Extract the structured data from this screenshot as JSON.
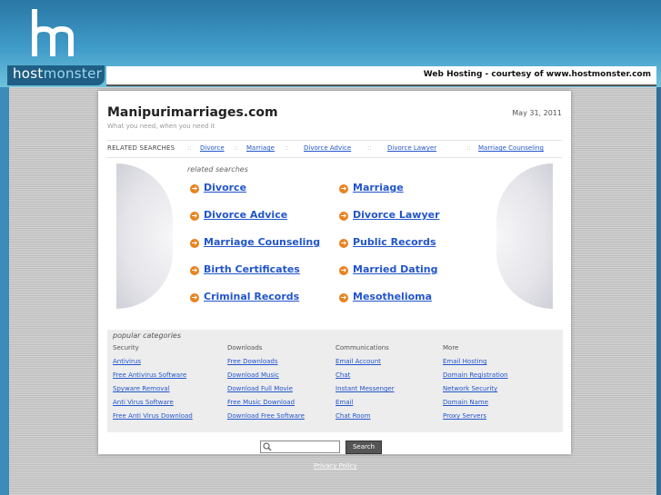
{
  "header": {
    "logo_text_1": "host",
    "logo_text_2": "monster",
    "courtesy": "Web Hosting - courtesy of www.hostmonster.com"
  },
  "site": {
    "title": "Manipurimarriages.com",
    "tagline": "What you need, when you need it",
    "date": "May 31, 2011"
  },
  "related_bar": {
    "label": "RELATED SEARCHES",
    "links": [
      "Divorce",
      "Marriage",
      "Divorce Advice",
      "Divorce Lawyer",
      "Marriage Counseling"
    ]
  },
  "related_searches": {
    "heading": "related searches",
    "left": [
      "Divorce",
      "Divorce Advice",
      "Marriage Counseling",
      "Birth Certificates",
      "Criminal Records"
    ],
    "right": [
      "Marriage",
      "Divorce Lawyer",
      "Public Records",
      "Married Dating",
      "Mesothelioma"
    ]
  },
  "popular": {
    "heading": "popular categories",
    "columns": [
      {
        "title": "Security",
        "links": [
          "Antivirus",
          "Free Antivirus Software",
          "Spyware Removal",
          "Anti Virus Software",
          "Free Anti Virus Download"
        ]
      },
      {
        "title": "Downloads",
        "links": [
          "Free Downloads",
          "Download Music",
          "Download Full Movie",
          "Free Music Download",
          "Download Free Software"
        ]
      },
      {
        "title": "Communications",
        "links": [
          "Email Account",
          "Chat",
          "Instant Messenger",
          "Email",
          "Chat Room"
        ]
      },
      {
        "title": "More",
        "links": [
          "Email Hosting",
          "Domain Registration",
          "Network Security",
          "Domain Name",
          "Proxy Servers"
        ]
      }
    ]
  },
  "search": {
    "button": "Search",
    "placeholder": ""
  },
  "footer": {
    "privacy": "Privacy Policy"
  }
}
